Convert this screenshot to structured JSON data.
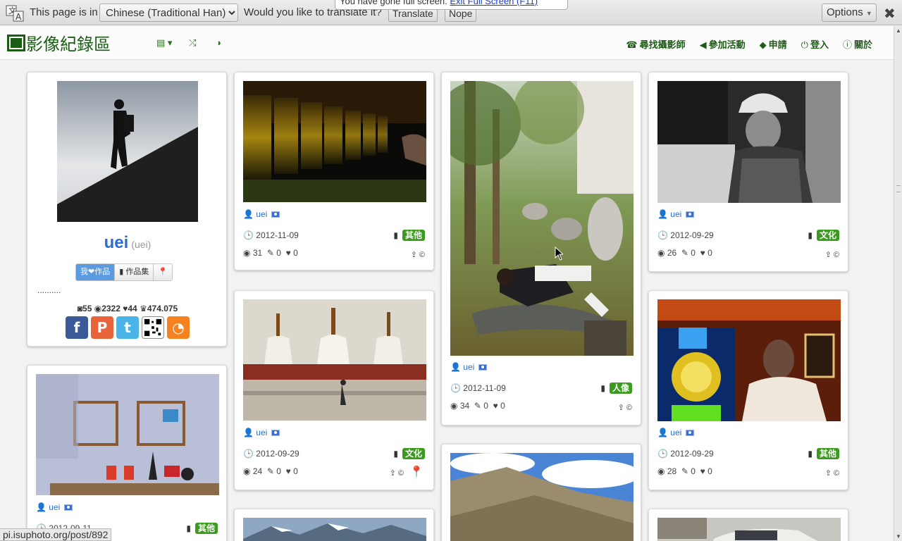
{
  "translate_bar": {
    "prefix": "This page is in",
    "language": "Chinese (Traditional Han)",
    "question": "Would you like to translate it?",
    "translate": "Translate",
    "nope": "Nope",
    "options": "Options",
    "close": "✖"
  },
  "fullscreen_notice": {
    "text": "You have gone full screen.",
    "exit": "Exit Full Screen (F11)"
  },
  "navbar": {
    "brand": "影像紀錄區",
    "links": [
      {
        "icon": "camera-icon",
        "label": "尋找攝影師"
      },
      {
        "icon": "megaphone-icon",
        "label": "參加活動"
      },
      {
        "icon": "tag-icon",
        "label": "申請"
      },
      {
        "icon": "power-icon",
        "label": "登入"
      },
      {
        "icon": "info-icon",
        "label": "關於"
      }
    ]
  },
  "profile": {
    "name": "uei",
    "username": "(uei)",
    "tabs": [
      "我❤作品",
      "作品集",
      "📍"
    ],
    "dots": "..........",
    "photos": "55",
    "views": "2322",
    "likes": "44",
    "score": "474.075"
  },
  "posts": [
    {
      "user": "uei",
      "date": "2012-11-09",
      "tag": "其他",
      "views": "31",
      "comments": "0",
      "likes": "0",
      "copyright": "©"
    },
    {
      "user": "uei",
      "date": "2012-09-29",
      "tag": "文化",
      "views": "24",
      "comments": "0",
      "likes": "0",
      "copyright": "©"
    },
    {
      "user": "uei",
      "date": "2012-11-09",
      "tag": "人像",
      "views": "34",
      "comments": "0",
      "likes": "0",
      "copyright": "©"
    },
    {
      "user": "uei",
      "date": "2012-09-29",
      "tag": "文化",
      "views": "26",
      "comments": "0",
      "likes": "0",
      "copyright": "©"
    },
    {
      "user": "uei",
      "date": "2012-09-29",
      "tag": "其他",
      "views": "28",
      "comments": "0",
      "likes": "0",
      "copyright": "©"
    },
    {
      "user": "uei",
      "date": "2012-09-11",
      "tag": "其他"
    }
  ],
  "status_url": "pi.isuphoto.org/post/892",
  "colors": {
    "brand": "#195e12",
    "badge": "#3c9a21",
    "link": "#2b6ed1"
  }
}
